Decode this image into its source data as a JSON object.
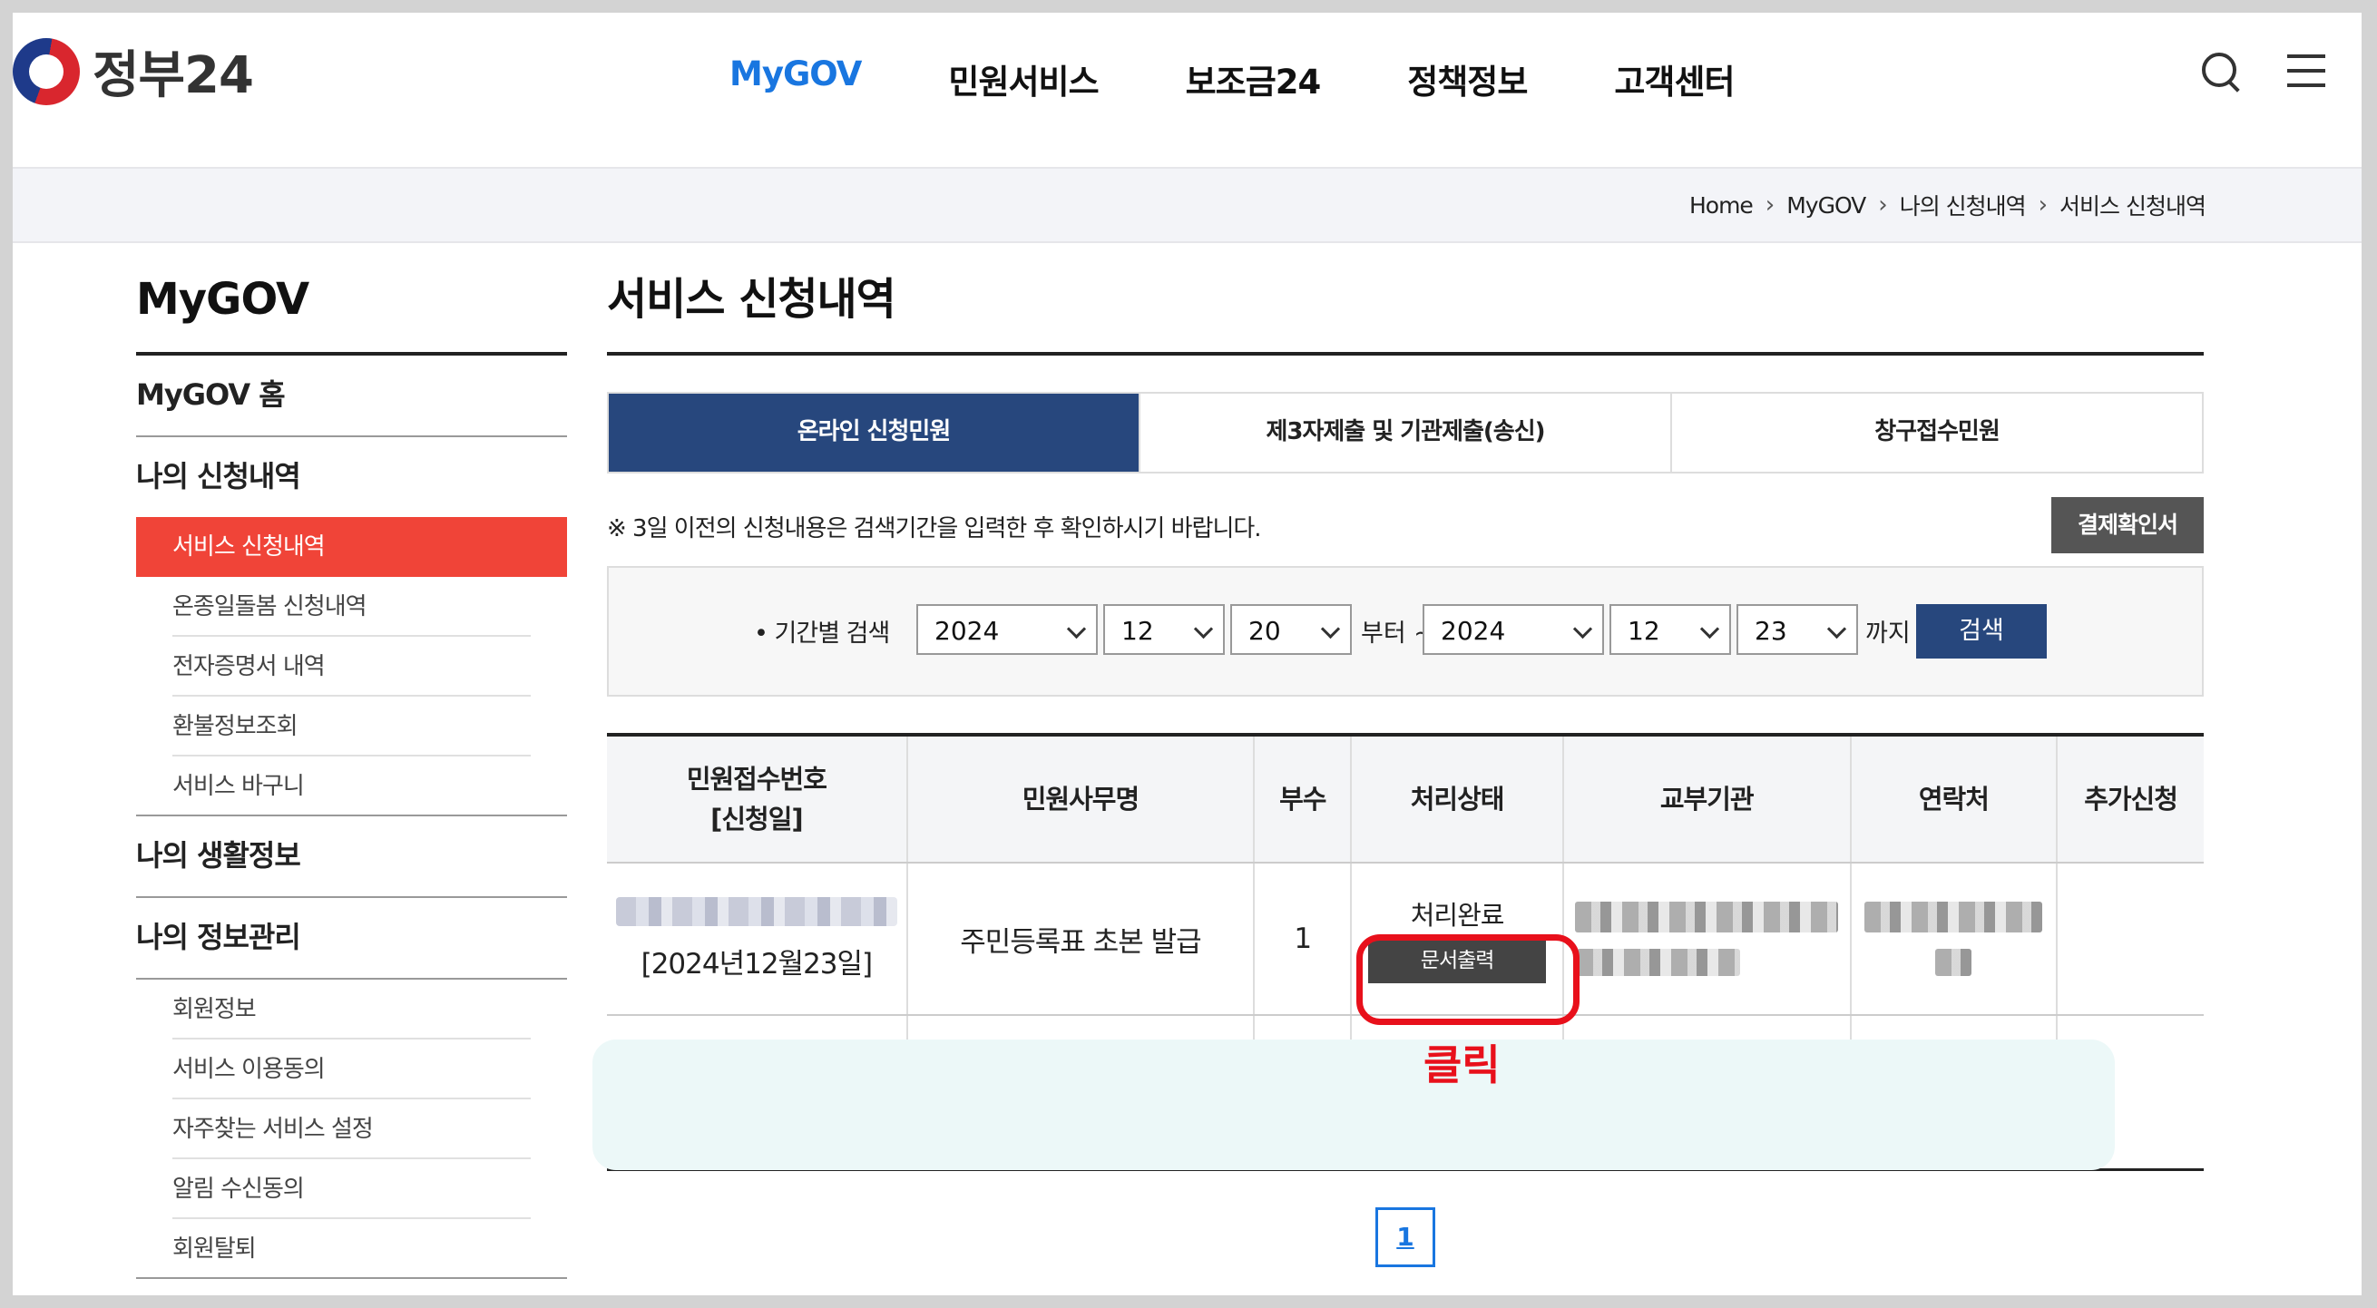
{
  "header": {
    "logo_text": "정부24",
    "nav": [
      "MyGOV",
      "민원서비스",
      "보조금24",
      "정책정보",
      "고객센터"
    ]
  },
  "breadcrumb": [
    "Home",
    "MyGOV",
    "나의 신청내역",
    "서비스 신청내역"
  ],
  "sidebar": {
    "title": "MyGOV",
    "home": "MyGOV 홈",
    "sec1": "나의 신청내역",
    "sec1_items": [
      "서비스 신청내역",
      "온종일돌봄 신청내역",
      "전자증명서 내역",
      "환불정보조회",
      "서비스 바구니"
    ],
    "sec2": "나의 생활정보",
    "sec3": "나의 정보관리",
    "sec3_items": [
      "회원정보",
      "서비스 이용동의",
      "자주찾는 서비스 설정",
      "알림 수신동의",
      "회원탈퇴"
    ]
  },
  "main": {
    "title": "서비스 신청내역",
    "tabs": [
      "온라인 신청민원",
      "제3자제출 및 기관제출(송신)",
      "창구접수민원"
    ],
    "notice": "※ 3일 이전의 신청내용은 검색기간을 입력한 후 확인하시기 바랍니다.",
    "receipt_btn": "결제확인서",
    "search": {
      "label": "• 기간별 검색",
      "from_year": "2024",
      "from_month": "12",
      "from_day": "20",
      "from_suffix": "부터 ~",
      "to_year": "2024",
      "to_month": "12",
      "to_day": "23",
      "to_suffix": "까지",
      "button": "검색"
    },
    "table": {
      "headers": [
        "민원접수번호\n[신청일]",
        "민원사무명",
        "부수",
        "처리상태",
        "교부기관",
        "연락처",
        "추가신청"
      ],
      "header_col1_line1": "민원접수번호",
      "header_col1_line2": "[신청일]",
      "row": {
        "date": "[2024년12월23일]",
        "name": "주민등록표 초본 발급",
        "count": "1",
        "status": "처리완료",
        "print_btn": "문서출력"
      }
    },
    "annotation": "클릭",
    "pagination": [
      "1"
    ]
  }
}
